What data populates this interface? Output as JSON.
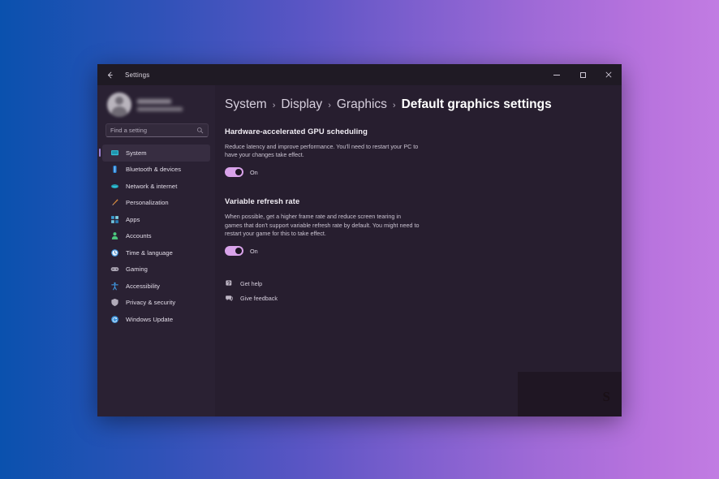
{
  "window": {
    "titlebar": {
      "back_icon": "back-arrow-icon",
      "title": "Settings",
      "minimize_label": "minimize",
      "maximize_label": "maximize",
      "close_label": "close"
    }
  },
  "sidebar": {
    "profile": {
      "avatar_alt": "user-avatar",
      "name_redacted": true,
      "email_redacted": true
    },
    "search": {
      "placeholder": "Find a setting",
      "value": "",
      "icon": "search-icon"
    },
    "items": [
      {
        "label": "System",
        "icon": "monitor-icon",
        "active": true,
        "color": "#35c0d6"
      },
      {
        "label": "Bluetooth & devices",
        "icon": "bluetooth-icon",
        "active": false,
        "color": "#2d8ce0"
      },
      {
        "label": "Network & internet",
        "icon": "network-globe-icon",
        "active": false,
        "color": "#2fbfd4"
      },
      {
        "label": "Personalization",
        "icon": "paintbrush-icon",
        "active": false,
        "color": "#d98b3a"
      },
      {
        "label": "Apps",
        "icon": "apps-grid-icon",
        "active": false,
        "color": "#3b9fd4"
      },
      {
        "label": "Accounts",
        "icon": "person-icon",
        "active": false,
        "color": "#4cc97e"
      },
      {
        "label": "Time & language",
        "icon": "clock-icon",
        "active": false,
        "color": "#3f96de"
      },
      {
        "label": "Gaming",
        "icon": "gamepad-icon",
        "active": false,
        "color": "#a9a3b1"
      },
      {
        "label": "Accessibility",
        "icon": "accessibility-icon",
        "active": false,
        "color": "#3f96de"
      },
      {
        "label": "Privacy & security",
        "icon": "shield-icon",
        "active": false,
        "color": "#b2abba"
      },
      {
        "label": "Windows Update",
        "icon": "update-icon",
        "active": false,
        "color": "#3f96de"
      }
    ]
  },
  "main": {
    "breadcrumb": [
      {
        "label": "System",
        "current": false
      },
      {
        "label": "Display",
        "current": false
      },
      {
        "label": "Graphics",
        "current": false
      },
      {
        "label": "Default graphics settings",
        "current": true
      }
    ],
    "breadcrumb_separator": "›",
    "sections": [
      {
        "title": "Hardware-accelerated GPU scheduling",
        "description": "Reduce latency and improve performance. You'll need to restart your PC to have your changes take effect.",
        "toggle": {
          "state": "On",
          "on": true
        }
      },
      {
        "title": "Variable refresh rate",
        "description": "When possible, get a higher frame rate and reduce screen tearing in games that don't support variable refresh rate by default. You might need to restart your game for this to take effect.",
        "toggle": {
          "state": "On",
          "on": true
        }
      }
    ],
    "links": [
      {
        "label": "Get help",
        "icon": "help-question-icon"
      },
      {
        "label": "Give feedback",
        "icon": "feedback-bubble-icon"
      }
    ],
    "watermark": "S"
  },
  "colors": {
    "accent_toggle": "#d9a3ea",
    "window_bg": "#271e2f",
    "sidebar_bg": "#2a2133",
    "titlebar_bg": "#1f1a24",
    "bg_gradient_start": "#0a51ae",
    "bg_gradient_end": "#c17ce2"
  }
}
